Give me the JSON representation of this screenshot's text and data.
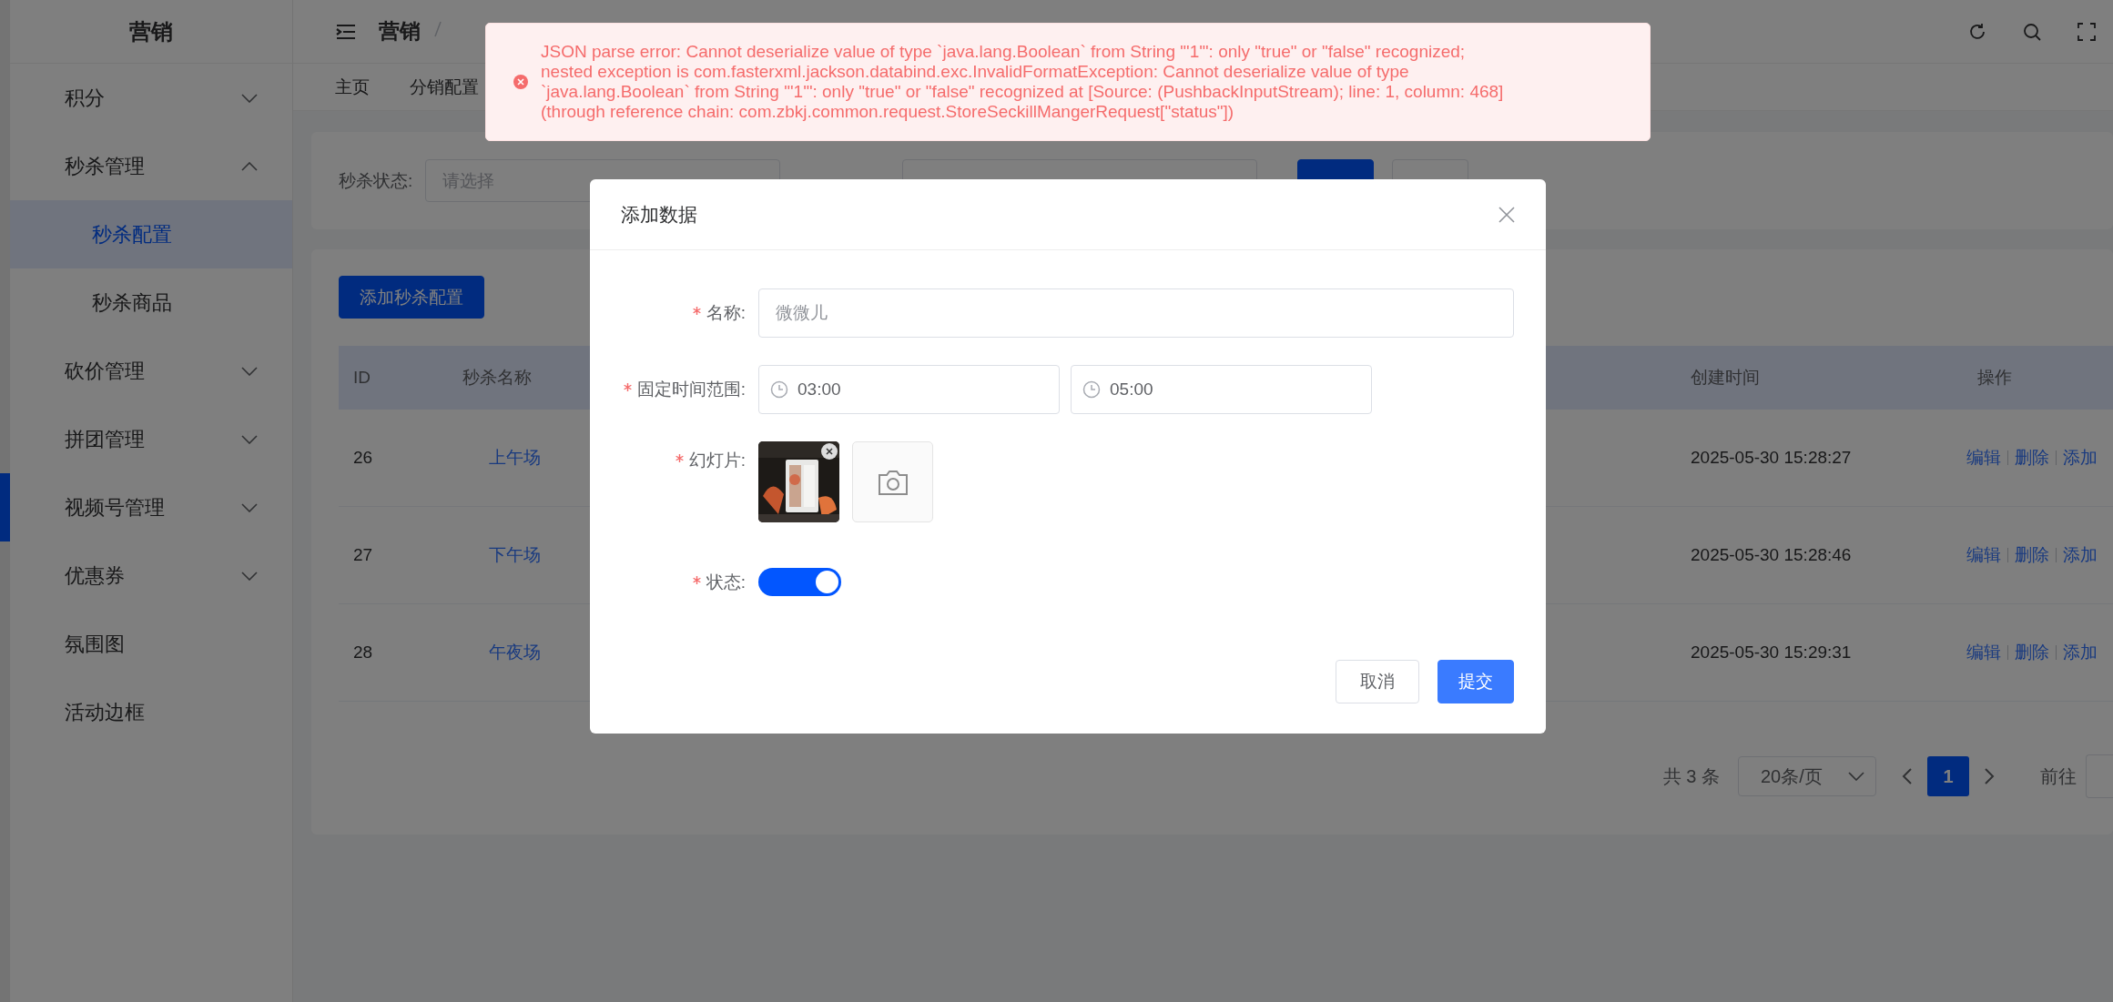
{
  "sidebar": {
    "title": "营销",
    "items": [
      {
        "label": "积分",
        "kind": "submenu",
        "expanded": false,
        "selected": false
      },
      {
        "label": "秒杀管理",
        "kind": "submenu",
        "expanded": true,
        "selected": false,
        "children": [
          {
            "label": "秒杀配置",
            "selected": true
          },
          {
            "label": "秒杀商品",
            "selected": false
          }
        ]
      },
      {
        "label": "砍价管理",
        "kind": "submenu",
        "expanded": false,
        "selected": false
      },
      {
        "label": "拼团管理",
        "kind": "submenu",
        "expanded": false,
        "selected": false
      },
      {
        "label": "视频号管理",
        "kind": "submenu",
        "expanded": false,
        "selected": false
      },
      {
        "label": "优惠券",
        "kind": "submenu",
        "expanded": false,
        "selected": false
      },
      {
        "label": "氛围图",
        "kind": "item",
        "selected": false
      },
      {
        "label": "活动边框",
        "kind": "item",
        "selected": false
      }
    ]
  },
  "header": {
    "breadcrumb": [
      "营销"
    ]
  },
  "tabs": [
    {
      "label": "主页",
      "selected": false
    },
    {
      "label": "分销配置",
      "selected": false
    }
  ],
  "search": {
    "fields": [
      {
        "label": "秒杀状态:",
        "placeholder": "请选择"
      }
    ],
    "buttons": [
      {
        "primary": true
      },
      {
        "primary": false
      }
    ]
  },
  "toolbar": {
    "add_button": "添加秒杀配置"
  },
  "table": {
    "columns": [
      "ID",
      "秒杀名称",
      "创建时间",
      "操作"
    ],
    "rows": [
      {
        "id": "26",
        "name": "上午场",
        "created": "2025-05-30 15:28:27",
        "actions": [
          "编辑",
          "删除",
          "添加"
        ]
      },
      {
        "id": "27",
        "name": "下午场",
        "created": "2025-05-30 15:28:46",
        "actions": [
          "编辑",
          "删除",
          "添加"
        ]
      },
      {
        "id": "28",
        "name": "午夜场",
        "created": "2025-05-30 15:29:31",
        "actions": [
          "编辑",
          "删除",
          "添加"
        ]
      }
    ]
  },
  "pagination": {
    "total": "共 3 条",
    "page_size": "20条/页",
    "pages": [
      {
        "label": "1",
        "selected": true
      }
    ],
    "jump_label": "前往"
  },
  "dialog": {
    "title": "添加数据",
    "fields": [
      {
        "kind": "text",
        "label": "名称:",
        "required": true,
        "value": "微微儿"
      },
      {
        "kind": "timerange",
        "label": "固定时间范围:",
        "required": true,
        "start": "03:00",
        "end": "05:00"
      },
      {
        "kind": "images",
        "label": "幻灯片:",
        "required": true
      },
      {
        "kind": "switch",
        "label": "状态:",
        "required": true,
        "on": true
      }
    ],
    "buttons": [
      {
        "label": "取消",
        "primary": false
      },
      {
        "label": "提交",
        "primary": true
      }
    ]
  },
  "toast": {
    "kind": "error",
    "lines": [
      "JSON parse error: Cannot deserialize value of type `java.lang.Boolean` from String \"'1'\": only \"true\" or \"false\" recognized;",
      "nested exception is com.fasterxml.jackson.databind.exc.InvalidFormatException: Cannot deserialize value of type",
      "`java.lang.Boolean` from String \"'1'\": only \"true\" or \"false\" recognized at [Source: (PushbackInputStream); line: 1, column: 468]",
      "(through reference chain: com.zbkj.common.request.StoreSeckillMangerRequest[\"status\"])"
    ]
  }
}
